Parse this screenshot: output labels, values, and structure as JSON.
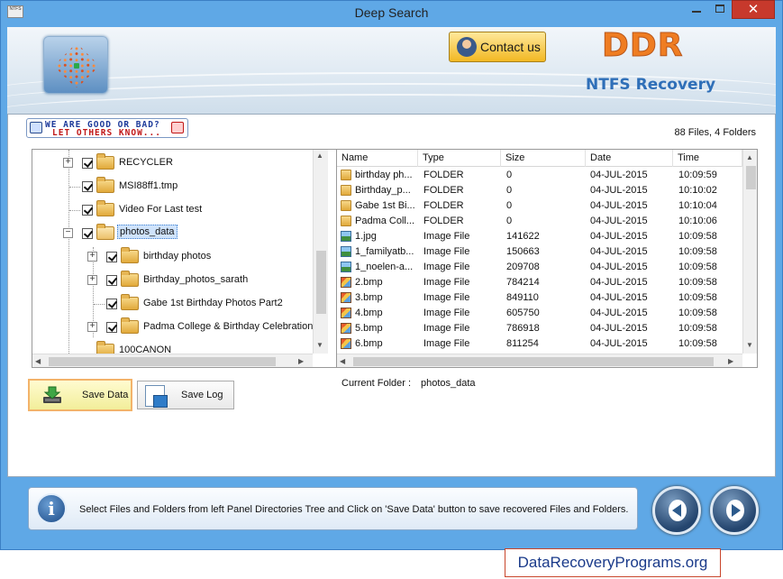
{
  "window": {
    "title": "Deep Search",
    "app_icon_text": "NTFS",
    "close_glyph": "✕"
  },
  "header": {
    "contact_label": "Contact us",
    "brand": "DDR",
    "product": "NTFS Recovery",
    "brand_color": "#ef7d22",
    "product_color": "#2f6fb8"
  },
  "feedback": {
    "line1": "WE ARE GOOD OR BAD?",
    "line2": "LET OTHERS KNOW..."
  },
  "summary": "88 Files, 4 Folders",
  "tree": {
    "items": [
      {
        "label": "RECYCLER",
        "level": 1,
        "expander": "+"
      },
      {
        "label": "MSI88ff1.tmp",
        "level": 1,
        "expander": ""
      },
      {
        "label": "Video For Last test",
        "level": 1,
        "expander": ""
      },
      {
        "label": "photos_data",
        "level": 1,
        "expander": "−",
        "selected": true
      },
      {
        "label": "birthday photos",
        "level": 2,
        "expander": "+"
      },
      {
        "label": "Birthday_photos_sarath",
        "level": 2,
        "expander": "+"
      },
      {
        "label": "Gabe 1st Birthday Photos Part2",
        "level": 2,
        "expander": ""
      },
      {
        "label": "Padma College & Birthday Celebration P",
        "level": 2,
        "expander": "+"
      },
      {
        "label": "100CANON",
        "level": 1,
        "expander": ""
      }
    ]
  },
  "list": {
    "columns": [
      "Name",
      "Type",
      "Size",
      "Date",
      "Time"
    ],
    "rows": [
      {
        "icon": "folder",
        "name": "birthday ph...",
        "type": "FOLDER",
        "size": "0",
        "date": "04-JUL-2015",
        "time": "10:09:59"
      },
      {
        "icon": "folder",
        "name": "Birthday_p...",
        "type": "FOLDER",
        "size": "0",
        "date": "04-JUL-2015",
        "time": "10:10:02"
      },
      {
        "icon": "folder",
        "name": "Gabe 1st Bi...",
        "type": "FOLDER",
        "size": "0",
        "date": "04-JUL-2015",
        "time": "10:10:04"
      },
      {
        "icon": "folder",
        "name": "Padma Coll...",
        "type": "FOLDER",
        "size": "0",
        "date": "04-JUL-2015",
        "time": "10:10:06"
      },
      {
        "icon": "jpg",
        "name": "1.jpg",
        "type": "Image File",
        "size": "141622",
        "date": "04-JUL-2015",
        "time": "10:09:58"
      },
      {
        "icon": "jpg",
        "name": "1_familyatb...",
        "type": "Image File",
        "size": "150663",
        "date": "04-JUL-2015",
        "time": "10:09:58"
      },
      {
        "icon": "jpg",
        "name": "1_noelen-a...",
        "type": "Image File",
        "size": "209708",
        "date": "04-JUL-2015",
        "time": "10:09:58"
      },
      {
        "icon": "bmp",
        "name": "2.bmp",
        "type": "Image File",
        "size": "784214",
        "date": "04-JUL-2015",
        "time": "10:09:58"
      },
      {
        "icon": "bmp",
        "name": "3.bmp",
        "type": "Image File",
        "size": "849110",
        "date": "04-JUL-2015",
        "time": "10:09:58"
      },
      {
        "icon": "bmp",
        "name": "4.bmp",
        "type": "Image File",
        "size": "605750",
        "date": "04-JUL-2015",
        "time": "10:09:58"
      },
      {
        "icon": "bmp",
        "name": "5.bmp",
        "type": "Image File",
        "size": "786918",
        "date": "04-JUL-2015",
        "time": "10:09:58"
      },
      {
        "icon": "bmp",
        "name": "6.bmp",
        "type": "Image File",
        "size": "811254",
        "date": "04-JUL-2015",
        "time": "10:09:58"
      }
    ]
  },
  "current_folder": {
    "label": "Current Folder :",
    "value": "photos_data"
  },
  "actions": {
    "save_data": "Save Data",
    "save_log": "Save Log"
  },
  "info": {
    "icon_glyph": "i",
    "text": "Select Files and Folders from left Panel Directories Tree and Click on 'Save Data' button to save recovered Files and Folders."
  },
  "watermark": "DataRecoveryPrograms.org"
}
